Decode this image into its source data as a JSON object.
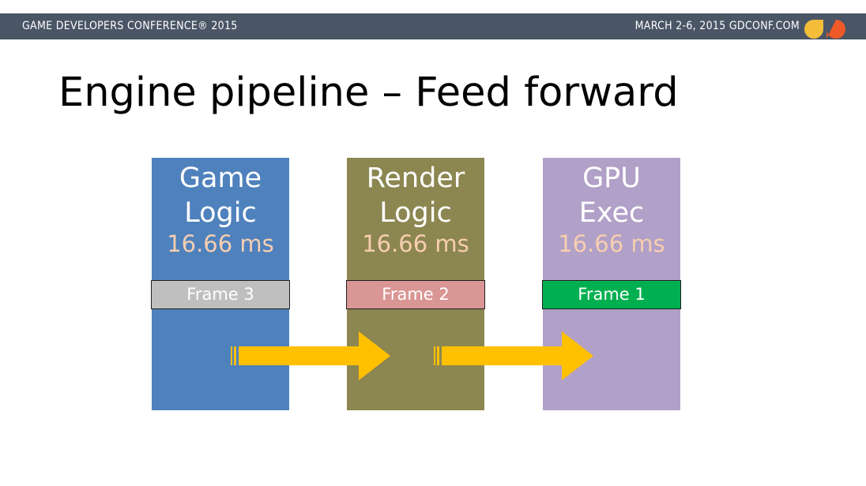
{
  "header": {
    "conference": "GAME DEVELOPERS CONFERENCE® 2015",
    "dates_site": "MARCH 2-6, 2015  GDCONF.COM"
  },
  "slide": {
    "title": "Engine pipeline – Feed forward"
  },
  "stages": [
    {
      "name_line1": "Game",
      "name_line2": "Logic",
      "time": "16.66 ms",
      "frame": "Frame 3",
      "color": "#4f81bd",
      "frame_color": "#bfbfbf"
    },
    {
      "name_line1": "Render",
      "name_line2": "Logic",
      "time": "16.66 ms",
      "frame": "Frame 2",
      "color": "#8c8651",
      "frame_color": "#d99694"
    },
    {
      "name_line1": "GPU",
      "name_line2": "Exec",
      "time": "16.66 ms",
      "frame": "Frame 1",
      "color": "#b1a0c7",
      "frame_color": "#00b050"
    }
  ],
  "colors": {
    "header_bar": "#4a5566",
    "arrow": "#ffc000",
    "time_text": "#f7ceb0",
    "logo_yellow": "#f3bd3a",
    "logo_orange": "#f05a28"
  }
}
